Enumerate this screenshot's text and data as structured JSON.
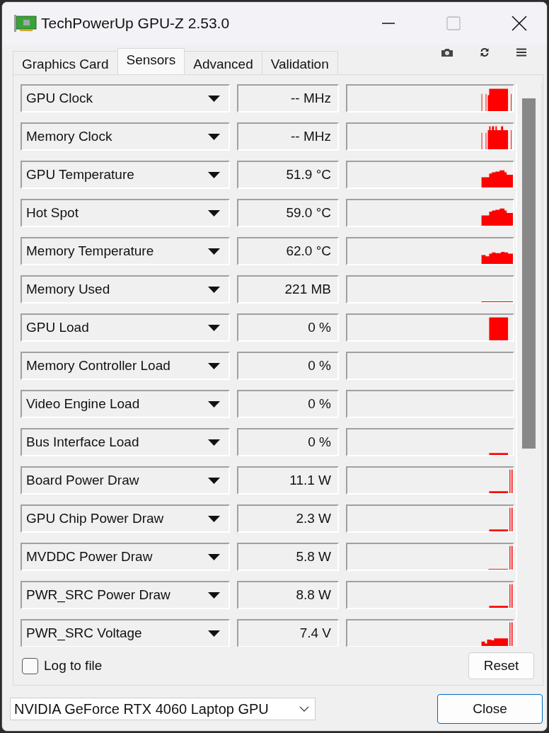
{
  "window": {
    "title": "TechPowerUp GPU-Z 2.53.0"
  },
  "tabs": [
    {
      "label": "Graphics Card",
      "selected": false
    },
    {
      "label": "Sensors",
      "selected": true
    },
    {
      "label": "Advanced",
      "selected": false
    },
    {
      "label": "Validation",
      "selected": false
    }
  ],
  "sensors": [
    {
      "name": "GPU Clock",
      "value": "-- MHz",
      "kind": "clock"
    },
    {
      "name": "Memory Clock",
      "value": "-- MHz",
      "kind": "clock2"
    },
    {
      "name": "GPU Temperature",
      "value": "51.9 °C",
      "kind": "hill"
    },
    {
      "name": "Hot Spot",
      "value": "59.0 °C",
      "kind": "hill"
    },
    {
      "name": "Memory Temperature",
      "value": "62.0 °C",
      "kind": "hill2"
    },
    {
      "name": "Memory Used",
      "value": "221 MB",
      "kind": "baseline"
    },
    {
      "name": "GPU Load",
      "value": "0 %",
      "kind": "block"
    },
    {
      "name": "Memory Controller Load",
      "value": "0 %",
      "kind": "empty"
    },
    {
      "name": "Video Engine Load",
      "value": "0 %",
      "kind": "empty"
    },
    {
      "name": "Bus Interface Load",
      "value": "0 %",
      "kind": "low"
    },
    {
      "name": "Board Power Draw",
      "value": "11.1 W",
      "kind": "power"
    },
    {
      "name": "GPU Chip Power Draw",
      "value": "2.3 W",
      "kind": "power"
    },
    {
      "name": "MVDDC Power Draw",
      "value": "5.8 W",
      "kind": "power2"
    },
    {
      "name": "PWR_SRC Power Draw",
      "value": "8.8 W",
      "kind": "power"
    },
    {
      "name": "PWR_SRC Voltage",
      "value": "7.4 V",
      "kind": "voltage"
    }
  ],
  "log_to_file": {
    "label": "Log to file",
    "checked": false
  },
  "reset_button": "Reset",
  "gpu_select": {
    "value": "NVIDIA GeForce RTX 4060 Laptop GPU"
  },
  "close_button": "Close"
}
